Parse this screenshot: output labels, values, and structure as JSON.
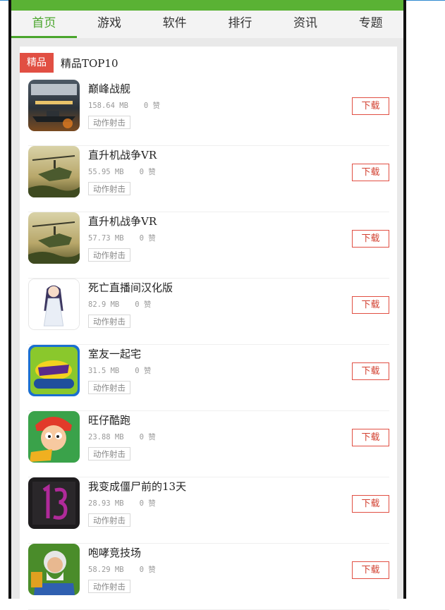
{
  "nav": {
    "items": [
      {
        "label": "首页",
        "active": true
      },
      {
        "label": "游戏",
        "active": false
      },
      {
        "label": "软件",
        "active": false
      },
      {
        "label": "排行",
        "active": false
      },
      {
        "label": "资讯",
        "active": false
      },
      {
        "label": "专题",
        "active": false
      }
    ]
  },
  "section": {
    "tag": "精品",
    "title": "精品TOP10"
  },
  "apps": [
    {
      "name": "巅峰战舰",
      "size": "158.64 MB",
      "likes": "0 赞",
      "category": "动作射击",
      "download": "下载",
      "icon": "warship-icon"
    },
    {
      "name": "直升机战争VR",
      "size": "55.95 MB",
      "likes": "0 赞",
      "category": "动作射击",
      "download": "下载",
      "icon": "helicopter-icon"
    },
    {
      "name": "直升机战争VR",
      "size": "57.73 MB",
      "likes": "0 赞",
      "category": "动作射击",
      "download": "下载",
      "icon": "helicopter-icon"
    },
    {
      "name": "死亡直播间汉化版",
      "size": "82.9 MB",
      "likes": "0 赞",
      "category": "动作射击",
      "download": "下载",
      "icon": "anime-girl-icon"
    },
    {
      "name": "室友一起宅",
      "size": "31.5 MB",
      "likes": "0 赞",
      "category": "动作射击",
      "download": "下载",
      "icon": "bigbrother-icon"
    },
    {
      "name": "旺仔酷跑",
      "size": "23.88 MB",
      "likes": "0 赞",
      "category": "动作射击",
      "download": "下载",
      "icon": "cartoon-boy-icon"
    },
    {
      "name": "我变成僵尸前的13天",
      "size": "28.93 MB",
      "likes": "0 赞",
      "category": "动作射击",
      "download": "下载",
      "icon": "number-13-icon"
    },
    {
      "name": "咆哮竞技场",
      "size": "58.29 MB",
      "likes": "0 赞",
      "category": "动作射击",
      "download": "下载",
      "icon": "old-warrior-icon"
    }
  ]
}
